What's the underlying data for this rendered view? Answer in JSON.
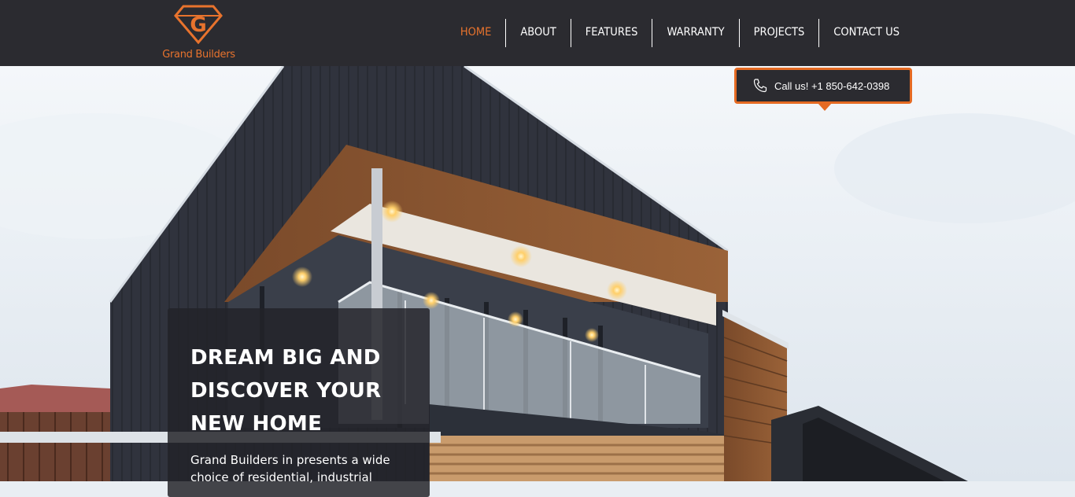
{
  "brand": {
    "name": "Grand Builders",
    "logo_letter": "G",
    "accent_color": "#e8732d"
  },
  "nav": {
    "items": [
      {
        "label": "HOME",
        "active": true
      },
      {
        "label": "ABOUT",
        "active": false
      },
      {
        "label": "FEATURES",
        "active": false
      },
      {
        "label": "WARRANTY",
        "active": false
      },
      {
        "label": "PROJECTS",
        "active": false
      },
      {
        "label": "CONTACT US",
        "active": false
      }
    ]
  },
  "callout": {
    "icon": "phone-icon",
    "text": "Call us! +1 850-642-0398"
  },
  "hero": {
    "title": "DREAM BIG AND DISCOVER YOUR NEW HOME",
    "description": "Grand Builders in presents a wide choice of residential, industrial"
  },
  "colors": {
    "header_bg": "#2b2b30",
    "accent": "#e8732d",
    "callout_border": "#e56a22"
  }
}
